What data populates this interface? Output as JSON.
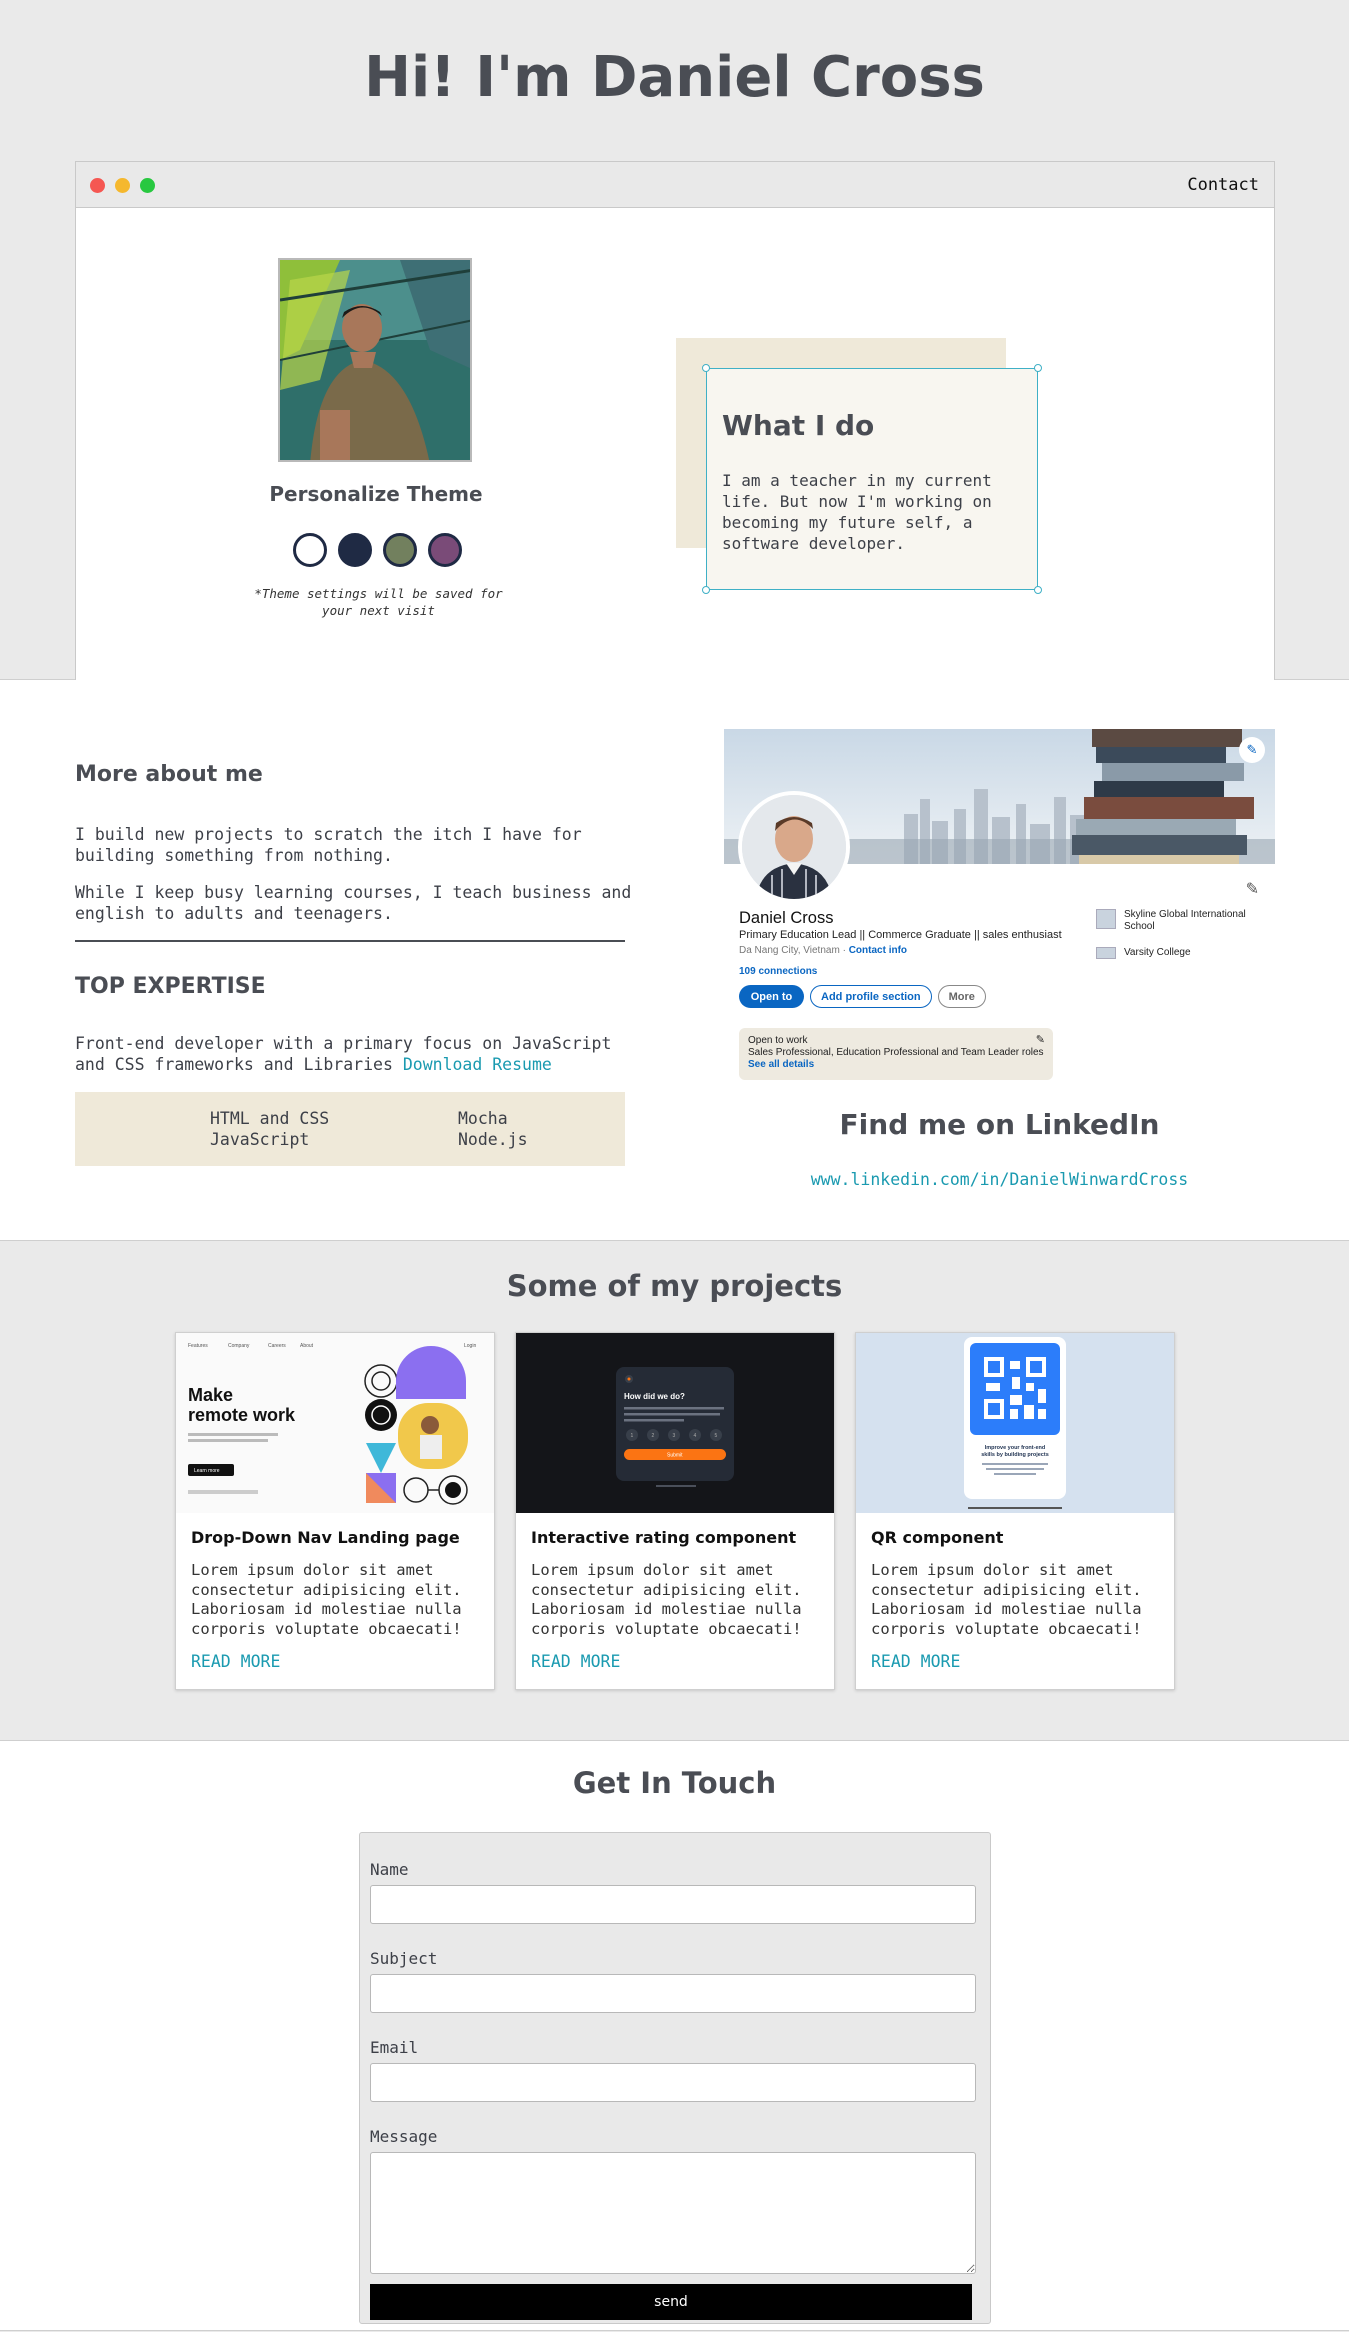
{
  "intro": {
    "greeting": "Hi! I'm Daniel Cross",
    "browser": {
      "contact_link": "Contact"
    },
    "theme": {
      "title": "Personalize Theme",
      "note": "*Theme settings will be saved for your next visit",
      "swatch_colors": [
        "#ffffff",
        "#1f2a44",
        "#72805e",
        "#7a4b78"
      ]
    },
    "what_i_do": {
      "title": "What I do",
      "text": "I am a teacher in my current life. But now I'm working on becoming my future self, a software developer."
    }
  },
  "about": {
    "title": "More about me",
    "paragraph_1": "I build new projects to scratch the itch I have for building something from nothing.",
    "paragraph_2": "While I keep busy learning courses, I teach business and english to adults and teenagers.",
    "expertise_title": "TOP EXPERTISE",
    "expertise_text": "Front-end developer with a primary focus on JavaScript and CSS frameworks and Libraries ",
    "download_link": "Download Resume",
    "skills": [
      "HTML and CSS",
      "JavaScript",
      "Mocha",
      "Node.js"
    ]
  },
  "linkedin": {
    "name": "Daniel Cross",
    "headline": "Primary Education Lead || Commerce Graduate || sales enthusiast",
    "location": "Da Nang City, Vietnam · ",
    "contact_info": "Contact info",
    "connections": "109 connections",
    "buttons": [
      "Open to",
      "Add profile section",
      "More"
    ],
    "open_to_work": {
      "title": "Open to work",
      "roles": "Sales Professional, Education Professional and Team Leader roles",
      "see_all": "See all details"
    },
    "orgs": [
      "Skyline Global International School",
      "Varsity College"
    ],
    "find_title": "Find me on LinkedIn",
    "url": "www.linkedin.com/in/DanielWinwardCross"
  },
  "projects": {
    "title": "Some of my projects",
    "items": [
      {
        "title": "Drop-Down Nav Landing page",
        "desc": "Lorem ipsum dolor sit amet consectetur adipisicing elit. Laboriosam id molestiae nulla corporis voluptate obcaecati!",
        "link": "READ MORE",
        "thumb": {
          "nav": [
            "Features",
            "Company",
            "Careers",
            "About",
            "Login"
          ],
          "headline_1": "Make",
          "headline_2": "remote work",
          "button": "Learn more"
        }
      },
      {
        "title": "Interactive rating component",
        "desc": "Lorem ipsum dolor sit amet consectetur adipisicing elit. Laboriosam id molestiae nulla corporis voluptate obcaecati!",
        "link": "READ MORE",
        "thumb": {
          "question": "How did we do?",
          "ratings": [
            "1",
            "2",
            "3",
            "4",
            "5"
          ],
          "submit": "Submit"
        }
      },
      {
        "title": "QR component",
        "desc": "Lorem ipsum dolor sit amet consectetur adipisicing elit. Laboriosam id molestiae nulla corporis voluptate obcaecati!",
        "link": "READ MORE",
        "thumb": {
          "caption_1": "Improve your front-end",
          "caption_2": "skills by building projects"
        }
      }
    ]
  },
  "contact": {
    "title": "Get In Touch",
    "labels": {
      "name": "Name",
      "subject": "Subject",
      "email": "Email",
      "message": "Message"
    },
    "send": "send"
  },
  "colors": {
    "accent": "#1a9ab0",
    "linkedin_blue": "#0a66c2",
    "beige": "#efe9d9"
  }
}
